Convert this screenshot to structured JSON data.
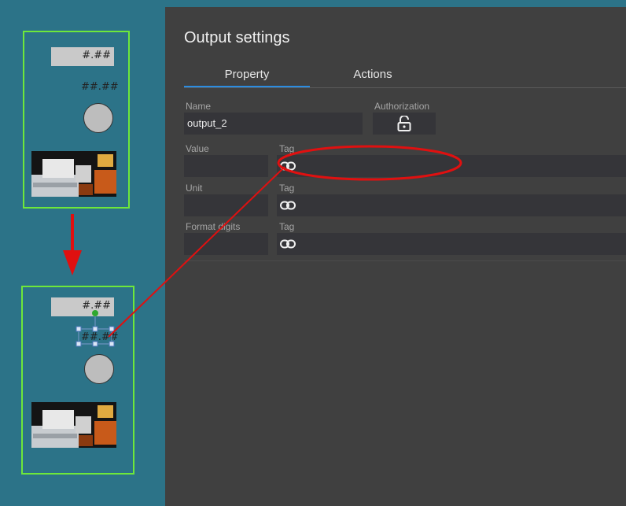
{
  "canvas": {
    "top_card": {
      "format_value": "#.##",
      "output_text": "##.##"
    },
    "bottom_card": {
      "format_value": "#.##",
      "output_text": "##.##"
    }
  },
  "panel": {
    "title": "Output settings",
    "tabs": [
      {
        "label": "Property",
        "active": true
      },
      {
        "label": "Actions",
        "active": false
      }
    ],
    "name_label": "Name",
    "name_value": "output_2",
    "authorization_label": "Authorization",
    "rows": [
      {
        "label": "Value",
        "tag_label": "Tag"
      },
      {
        "label": "Unit",
        "tag_label": "Tag"
      },
      {
        "label": "Format digits",
        "tag_label": "Tag"
      }
    ]
  },
  "icons": {
    "link": "link-icon",
    "lock": "unlock-icon"
  },
  "colors": {
    "card_border": "#6ee83a",
    "accent": "#2b8ce0",
    "annotation": "#e01010"
  }
}
